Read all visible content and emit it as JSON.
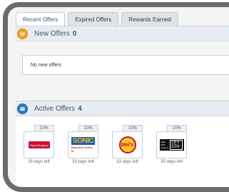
{
  "tabs": [
    {
      "label": "Recent Offers",
      "active": true
    },
    {
      "label": "Expired Offers",
      "active": false
    },
    {
      "label": "Rewards Earned",
      "active": false
    }
  ],
  "new_offers": {
    "title": "New Offers",
    "count": "0",
    "icon": "chevron-circle-icon",
    "empty_text": "No new offers"
  },
  "active_offers": {
    "title": "Active Offers",
    "count": "4",
    "icon": "card-circle-icon",
    "items": [
      {
        "badge": "10%",
        "logo": "papa-murphys-logo",
        "logo_text": "Papa Murphys",
        "days_left": "28 days left"
      },
      {
        "badge": "10%",
        "logo": "sonic-logo",
        "logo_text": "SONIC",
        "logo_subtext": "America's Drive-In.",
        "days_left": "33 days left"
      },
      {
        "badge": "10%",
        "logo": "mels-logo",
        "logo_text": "Mel's",
        "days_left": "33 days left"
      },
      {
        "badge": "10%",
        "logo": "saks-off-fifth-logo",
        "logo_text": "Saks Fifth Avenue",
        "logo_subtext": "OFF 5TH",
        "days_left": "35 days left"
      }
    ]
  },
  "colors": {
    "accent": "#2a7fc4",
    "count_blue": "#1f5f9a",
    "orange": "#f0a524",
    "frame": "#6b6b6b"
  }
}
